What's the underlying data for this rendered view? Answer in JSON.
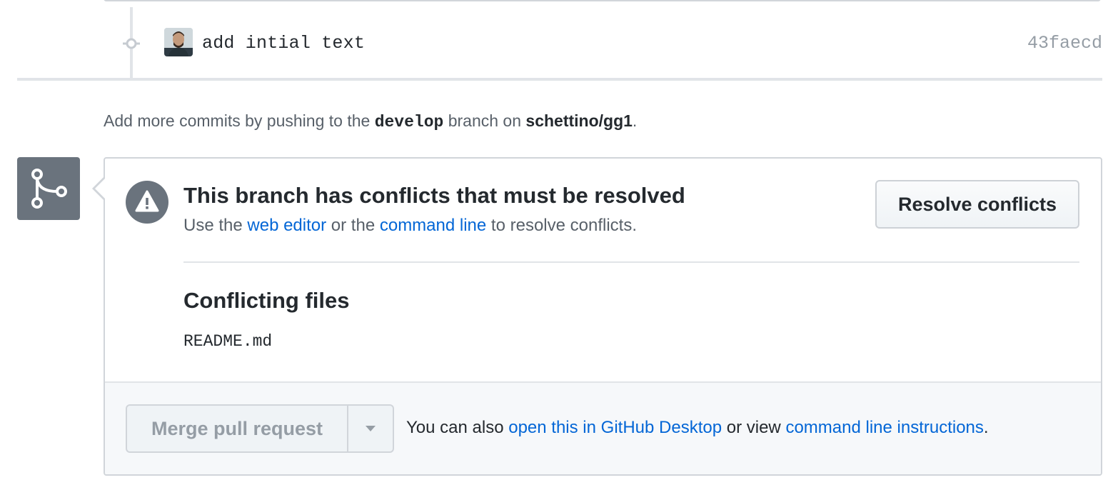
{
  "commit": {
    "message": "add intial text",
    "sha": "43faecd"
  },
  "push_note": {
    "prefix": "Add more commits by pushing to the",
    "branch": "develop",
    "middle": "branch on",
    "repo": "schettino/gg1",
    "suffix": "."
  },
  "merge_box": {
    "title": "This branch has conflicts that must be resolved",
    "sub_prefix": "Use the",
    "web_editor_link": "web editor",
    "sub_middle": "or the",
    "command_line_link": "command line",
    "sub_suffix": "to resolve conflicts.",
    "resolve_button": "Resolve conflicts",
    "files_heading": "Conflicting files",
    "files": [
      "README.md"
    ]
  },
  "footer": {
    "merge_button": "Merge pull request",
    "text_prefix": "You can also",
    "desktop_link": "open this in GitHub Desktop",
    "text_middle": "or view",
    "instructions_link": "command line instructions",
    "text_suffix": "."
  },
  "icons": {
    "commit": "git-commit-icon",
    "merge": "git-merge-icon",
    "alert": "alert-icon",
    "dropdown": "triangle-down-icon"
  },
  "colors": {
    "link": "#0366d6",
    "badge_gray": "#6a737d",
    "disabled_text": "#959da5"
  }
}
